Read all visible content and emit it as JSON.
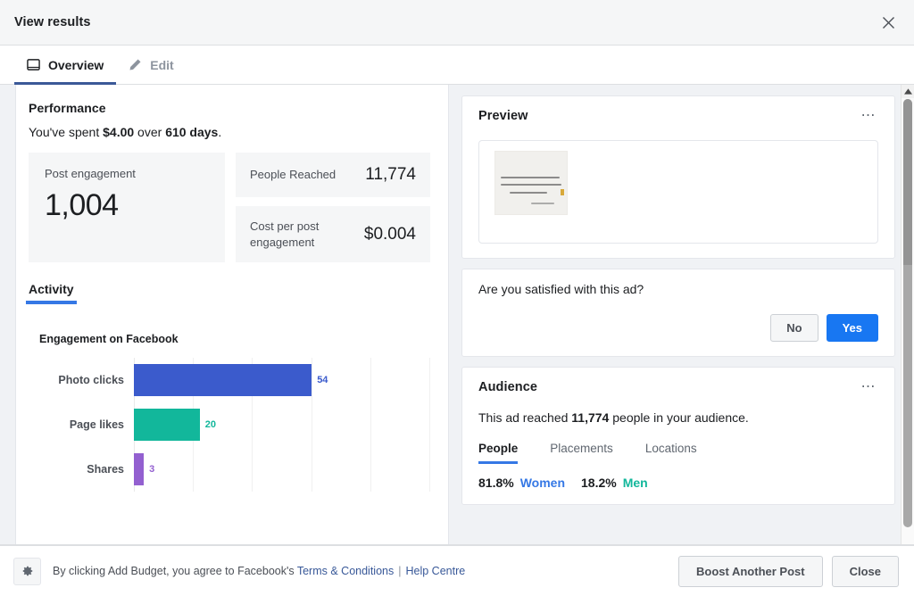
{
  "header": {
    "title": "View results",
    "close_icon": "close-icon"
  },
  "tabs": [
    {
      "label": "Overview",
      "icon": "monitor-icon",
      "active": true
    },
    {
      "label": "Edit",
      "icon": "pencil-icon",
      "active": false
    }
  ],
  "performance": {
    "title": "Performance",
    "summary_prefix": "You've spent ",
    "summary_amount": "$4.00",
    "summary_mid": " over ",
    "summary_days": "610 days",
    "summary_suffix": ".",
    "post_engagement_label": "Post engagement",
    "post_engagement_value": "1,004",
    "people_reached_label": "People Reached",
    "people_reached_value": "11,774",
    "cost_label": "Cost per post engagement",
    "cost_value": "$0.004"
  },
  "activity": {
    "tab_label": "Activity",
    "chart_title": "Engagement on Facebook"
  },
  "chart_data": {
    "type": "bar",
    "orientation": "horizontal",
    "title": "Engagement on Facebook",
    "categories": [
      "Photo clicks",
      "Page likes",
      "Shares"
    ],
    "values": [
      54,
      20,
      3
    ],
    "colors": [
      "#3b5bcc",
      "#12b79b",
      "#9360d0"
    ],
    "xlabel": "",
    "ylabel": "",
    "xlim": [
      0,
      90
    ],
    "gridlines": 5,
    "grid": true,
    "legend": "none",
    "data_labels": [
      "54",
      "20",
      "3"
    ]
  },
  "preview": {
    "title": "Preview",
    "menu_icon": "ellipsis-icon",
    "thumbnail_alt": "scanned-handwritten-letter"
  },
  "satisfaction": {
    "question": "Are you satisfied with this ad?",
    "no_label": "No",
    "yes_label": "Yes"
  },
  "audience": {
    "title": "Audience",
    "menu_icon": "ellipsis-icon",
    "reach_prefix": "This ad reached ",
    "reach_count": "11,774",
    "reach_suffix": " people in your audience.",
    "tabs": [
      {
        "label": "People",
        "active": true
      },
      {
        "label": "Placements",
        "active": false
      },
      {
        "label": "Locations",
        "active": false
      }
    ],
    "stats": [
      {
        "pct": "81.8%",
        "group": "Women",
        "color": "#3578e5"
      },
      {
        "pct": "18.2%",
        "group": "Men",
        "color": "#12b79b"
      }
    ]
  },
  "footer": {
    "gear_icon": "gear-icon",
    "legal_prefix": "By clicking Add Budget, you agree to Facebook's ",
    "terms_link": "Terms & Conditions",
    "separator": "|",
    "help_link": "Help Centre",
    "boost_label": "Boost Another Post",
    "close_label": "Close"
  },
  "colors": {
    "accent_blue": "#1877f2",
    "tab_blue": "#3578e5",
    "bar_blue": "#3b5bcc",
    "bar_teal": "#12b79b",
    "bar_purple": "#9360d0",
    "link": "#385898"
  }
}
